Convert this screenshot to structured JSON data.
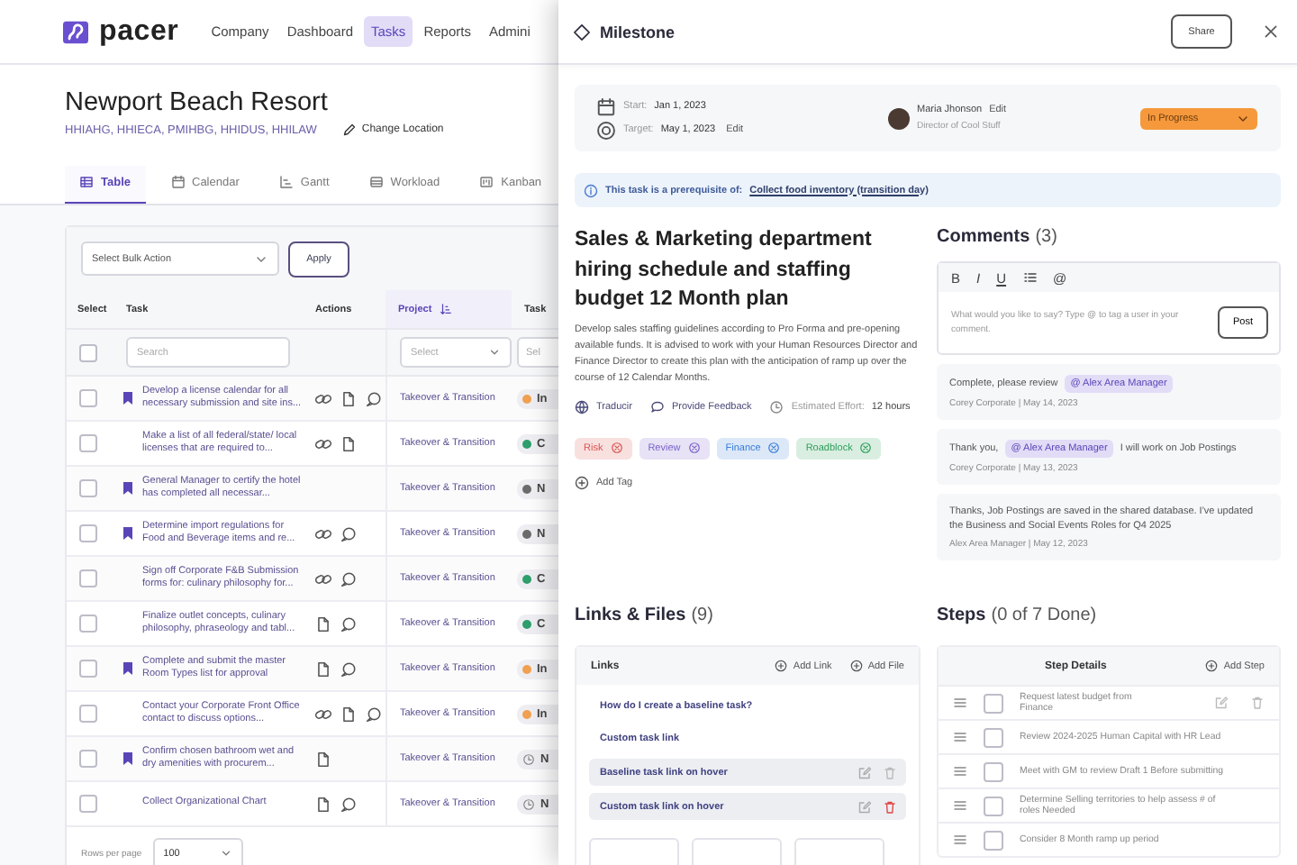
{
  "nav": {
    "logo": "pacer",
    "items": [
      {
        "label": "Company",
        "selected": false
      },
      {
        "label": "Dashboard",
        "selected": false
      },
      {
        "label": "Tasks",
        "selected": true
      },
      {
        "label": "Reports",
        "selected": false
      },
      {
        "label": "Admini",
        "selected": false
      }
    ]
  },
  "page": {
    "title": "Newport Beach Resort",
    "codes": "HHIAHG, HHIECA, PMIHBG, HHIDUS, HHILAW",
    "change_location": "Change Location"
  },
  "view_tabs": [
    {
      "label": "Table",
      "selected": true
    },
    {
      "label": "Calendar",
      "selected": false
    },
    {
      "label": "Gantt",
      "selected": false
    },
    {
      "label": "Workload",
      "selected": false
    },
    {
      "label": "Kanban",
      "selected": false
    }
  ],
  "toolbar": {
    "bulk_placeholder": "Select Bulk Action",
    "apply": "Apply"
  },
  "table": {
    "columns": [
      "Select",
      "Task",
      "Actions",
      "Project",
      "Task"
    ],
    "select_all_checked": false,
    "search_placeholder": "Search",
    "project_filter_placeholder": "Select",
    "status_filter_placeholder": "Sel",
    "rows": [
      {
        "checked": false,
        "flagged": true,
        "task": "Develop a license calendar for all necessary submission and site ins...",
        "links": true,
        "files": true,
        "comments": true,
        "project": "Takeover & Transition",
        "status": {
          "text": "In",
          "kind": "dot",
          "color": "#f0a050"
        }
      },
      {
        "checked": false,
        "flagged": false,
        "task": "Make a list of all federal/state/ local licenses that are required to...",
        "links": true,
        "files": true,
        "comments": false,
        "project": "Takeover & Transition",
        "status": {
          "text": "C",
          "kind": "dot",
          "color": "#2e9e6b"
        }
      },
      {
        "checked": false,
        "flagged": true,
        "task": "General Manager to certify the hotel has completed all necessar...",
        "links": false,
        "files": false,
        "comments": false,
        "project": "Takeover & Transition",
        "status": {
          "text": "N",
          "kind": "dot",
          "color": "#6b6b6b"
        }
      },
      {
        "checked": false,
        "flagged": true,
        "task": "Determine import regulations for Food and Beverage items and re...",
        "links": true,
        "files": false,
        "comments": true,
        "project": "Takeover & Transition",
        "status": {
          "text": "N",
          "kind": "dot",
          "color": "#6b6b6b"
        }
      },
      {
        "checked": false,
        "flagged": false,
        "task": "Sign off Corporate F&B Submission forms for: culinary philosophy for...",
        "links": true,
        "files": false,
        "comments": true,
        "project": "Takeover & Transition",
        "status": {
          "text": "C",
          "kind": "dot",
          "color": "#2e9e6b"
        }
      },
      {
        "checked": false,
        "flagged": false,
        "task": "Finalize outlet concepts, culinary philosophy, phraseology and tabl...",
        "links": false,
        "files": true,
        "comments": true,
        "project": "Takeover & Transition",
        "status": {
          "text": "C",
          "kind": "dot",
          "color": "#2e9e6b"
        }
      },
      {
        "checked": false,
        "flagged": true,
        "task": "Complete and submit the master Room Types list for approval",
        "links": false,
        "files": true,
        "comments": true,
        "project": "Takeover & Transition",
        "status": {
          "text": "In",
          "kind": "dot",
          "color": "#f0a050"
        }
      },
      {
        "checked": false,
        "flagged": false,
        "task": "Contact your Corporate Front Office contact to discuss options...",
        "links": true,
        "files": true,
        "comments": true,
        "project": "Takeover & Transition",
        "status": {
          "text": "In",
          "kind": "dot",
          "color": "#f0a050"
        }
      },
      {
        "checked": false,
        "flagged": true,
        "task": "Confirm chosen bathroom wet and dry amenities with procurem...",
        "links": false,
        "files": true,
        "comments": false,
        "project": "Takeover & Transition",
        "status": {
          "text": "N",
          "kind": "clock"
        }
      },
      {
        "checked": false,
        "flagged": false,
        "task": "Collect Organizational Chart",
        "links": false,
        "files": true,
        "comments": true,
        "project": "Takeover & Transition",
        "status": {
          "text": "N",
          "kind": "clock"
        }
      }
    ]
  },
  "footer": {
    "rows_per_page_label": "Rows per page",
    "rows_per_page": "100"
  },
  "drawer": {
    "title": "Milestone",
    "share": "Share",
    "dates": {
      "start_label": "Start:",
      "start": "Jan 1, 2023",
      "target_label": "Target:",
      "target": "May 1, 2023",
      "edit": "Edit"
    },
    "owner": {
      "name": "Maria Jhonson",
      "edit": "Edit",
      "role": "Director of Cool Stuff"
    },
    "status": "In Progress",
    "notice": {
      "text": "This task is a prerequisite of:",
      "link": "Collect food inventory (transition day)"
    },
    "task": {
      "title": "Sales & Marketing department hiring schedule and staffing budget 12 Month plan",
      "description": "Develop sales staffing guidelines according to Pro Forma and pre-opening available funds. It is advised to work with your Human Resources Director and Finance Director to create this plan with the anticipation of ramp up over the course of 12 Calendar Months.",
      "translate": "Traducir",
      "feedback": "Provide Feedback",
      "effort_label": "Estimated Effort:",
      "effort": "12 hours",
      "tags": [
        {
          "label": "Risk",
          "color": "#d9534f"
        },
        {
          "label": "Review",
          "color": "#7b61c9"
        },
        {
          "label": "Finance",
          "color": "#3b7dd8"
        },
        {
          "label": "Roadblock",
          "color": "#2e9e5b"
        }
      ],
      "add_tag": "Add Tag"
    },
    "comments": {
      "title": "Comments",
      "count": "(3)",
      "format_buttons": [
        "B",
        "I",
        "U"
      ],
      "mention_button": "@",
      "placeholder": "What would you like to say? Type @ to tag a user in your comment.",
      "post": "Post",
      "items": [
        {
          "parts": [
            {
              "kind": "text",
              "text": "Complete, please review"
            },
            {
              "kind": "mention",
              "text": "@ Alex Area Manager"
            }
          ],
          "meta": "Corey Corporate | May 14, 2023"
        },
        {
          "parts": [
            {
              "kind": "text",
              "text": "Thank you,"
            },
            {
              "kind": "mention",
              "text": "@ Alex Area Manager"
            },
            {
              "kind": "text",
              "text": "I will work on Job Postings"
            }
          ],
          "meta": "Corey Corporate | May 13, 2023"
        },
        {
          "parts": [
            {
              "kind": "text",
              "text": "Thanks, Job Postings are saved in the shared database. I've updated the Business and Social Events Roles for Q4 2025"
            }
          ],
          "meta": "Alex Area Manager | May 12, 2023"
        }
      ]
    },
    "links": {
      "title": "Links & Files",
      "count": "(9)",
      "panel_title": "Links",
      "add_link": "Add Link",
      "add_file": "Add File",
      "items": [
        {
          "text": "How do I create a baseline task?",
          "highlighted": false
        },
        {
          "text": "Custom task link",
          "highlighted": false
        },
        {
          "text": "Baseline task link on hover",
          "highlighted": true,
          "delete_armed": false
        },
        {
          "text": "Custom task link on hover",
          "highlighted": true,
          "delete_armed": true
        }
      ]
    },
    "steps": {
      "title": "Steps",
      "count": "(0 of 7 Done)",
      "header": "Step Details",
      "add_step": "Add Step",
      "items": [
        {
          "text": "Request latest budget from Finance",
          "checked": false,
          "tools": true
        },
        {
          "text": "Review 2024-2025 Human Capital with HR Lead",
          "checked": false,
          "tools": false
        },
        {
          "text": "Meet with GM to review Draft 1 Before submitting",
          "checked": false,
          "tools": false
        },
        {
          "text": "Determine Selling territories to help assess # of roles Needed",
          "checked": false,
          "tools": false
        },
        {
          "text": "Consider 8 Month ramp up period",
          "checked": false,
          "tools": false
        }
      ]
    }
  }
}
